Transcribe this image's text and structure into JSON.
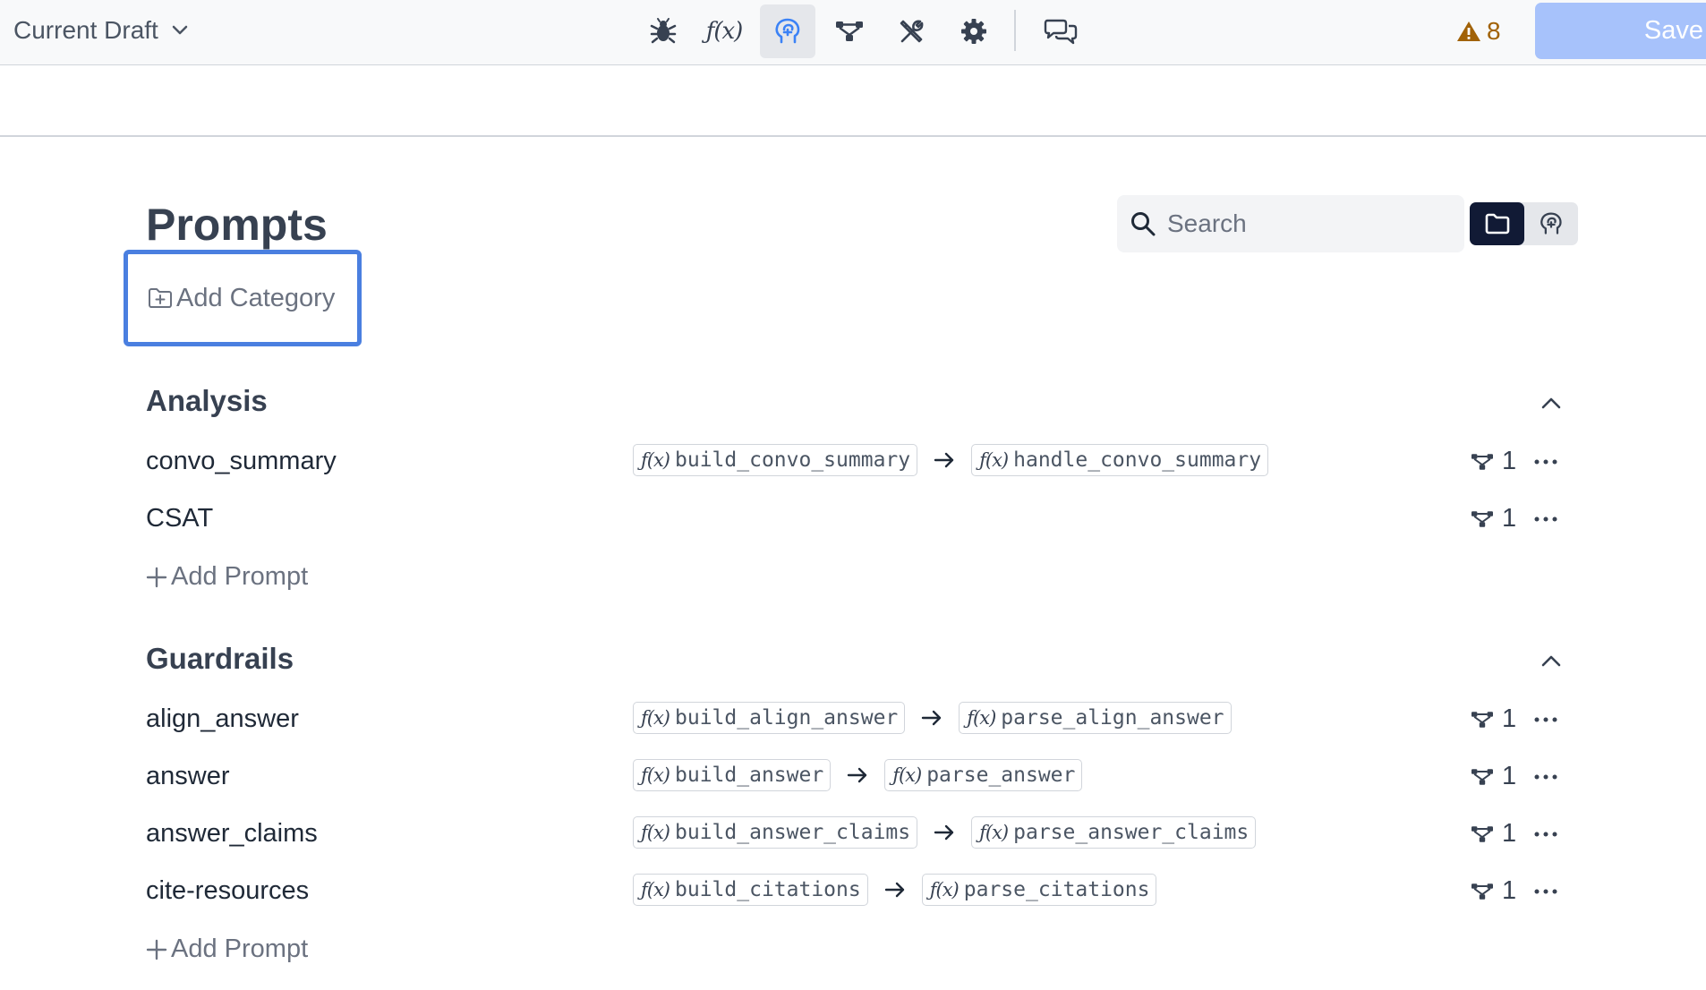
{
  "topbar": {
    "draft_label": "Current Draft",
    "warning_count": "8",
    "save_label": "Save"
  },
  "page": {
    "title": "Prompts",
    "add_category_label": "Add Category",
    "search_placeholder": "Search"
  },
  "sections": [
    {
      "title": "Analysis",
      "rows": [
        {
          "name": "convo_summary",
          "build_fn": "build_convo_summary",
          "handle_fn": "handle_convo_summary",
          "count": "1"
        },
        {
          "name": "CSAT",
          "build_fn": "",
          "handle_fn": "",
          "count": "1"
        }
      ],
      "add_label": "Add Prompt"
    },
    {
      "title": "Guardrails",
      "rows": [
        {
          "name": "align_answer",
          "build_fn": "build_align_answer",
          "handle_fn": "parse_align_answer",
          "count": "1"
        },
        {
          "name": "answer",
          "build_fn": "build_answer",
          "handle_fn": "parse_answer",
          "count": "1"
        },
        {
          "name": "answer_claims",
          "build_fn": "build_answer_claims",
          "handle_fn": "parse_answer_claims",
          "count": "1"
        },
        {
          "name": "cite-resources",
          "build_fn": "build_citations",
          "handle_fn": "parse_citations",
          "count": "1"
        }
      ],
      "add_label": "Add Prompt"
    }
  ],
  "colors": {
    "accent": "#3b82f6",
    "focus_border": "#4a7fe0",
    "save_bg": "#a7c2fb",
    "warning": "#a16207",
    "toggle_active": "#111a35"
  },
  "icons": {
    "topbar": [
      "bug-icon",
      "function-icon",
      "brain-icon",
      "flow-icon",
      "tools-icon",
      "gear-icon",
      "chat-icon"
    ],
    "row": [
      "flow-icon",
      "more-icon"
    ]
  }
}
